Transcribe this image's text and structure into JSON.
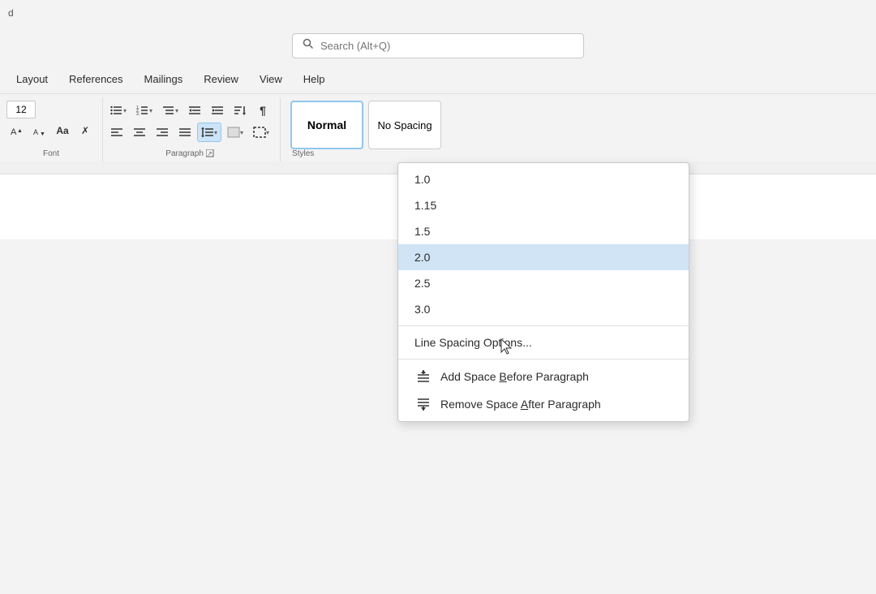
{
  "titleBar": {
    "searchPlaceholder": "Search (Alt+Q)"
  },
  "menuBar": {
    "items": [
      "Layout",
      "References",
      "Mailings",
      "Review",
      "View",
      "Help"
    ]
  },
  "ribbon": {
    "fontSection": {
      "label": "Font",
      "fontSize": "12"
    },
    "paragraphSection": {
      "label": "Paragraph"
    },
    "stylesSection": {
      "label": "Styles",
      "items": [
        "Normal",
        "No Spacing"
      ]
    }
  },
  "dropdown": {
    "lineSpacingOptions": [
      {
        "value": "1.0",
        "highlighted": false
      },
      {
        "value": "1.15",
        "highlighted": false
      },
      {
        "value": "1.5",
        "highlighted": false
      },
      {
        "value": "2.0",
        "highlighted": true
      },
      {
        "value": "2.5",
        "highlighted": false
      },
      {
        "value": "3.0",
        "highlighted": false
      }
    ],
    "actions": [
      {
        "label": "Line Spacing Options...",
        "icon": ""
      },
      {
        "label": "Add Space Before Paragraph",
        "icon": "add-space-before"
      },
      {
        "label": "Remove Space After Paragraph",
        "icon": "remove-space-after"
      }
    ]
  },
  "labels": {
    "font": "Font",
    "paragraph": "Paragraph",
    "styles": "Styles",
    "normal": "Normal",
    "noSpacing": "No Spacing",
    "lineSpacingOptions": "Line Spacing Options...",
    "addSpaceBefore": "Add Space Before Paragraph",
    "removeSpaceAfter": "Remove Space After Paragraph"
  }
}
